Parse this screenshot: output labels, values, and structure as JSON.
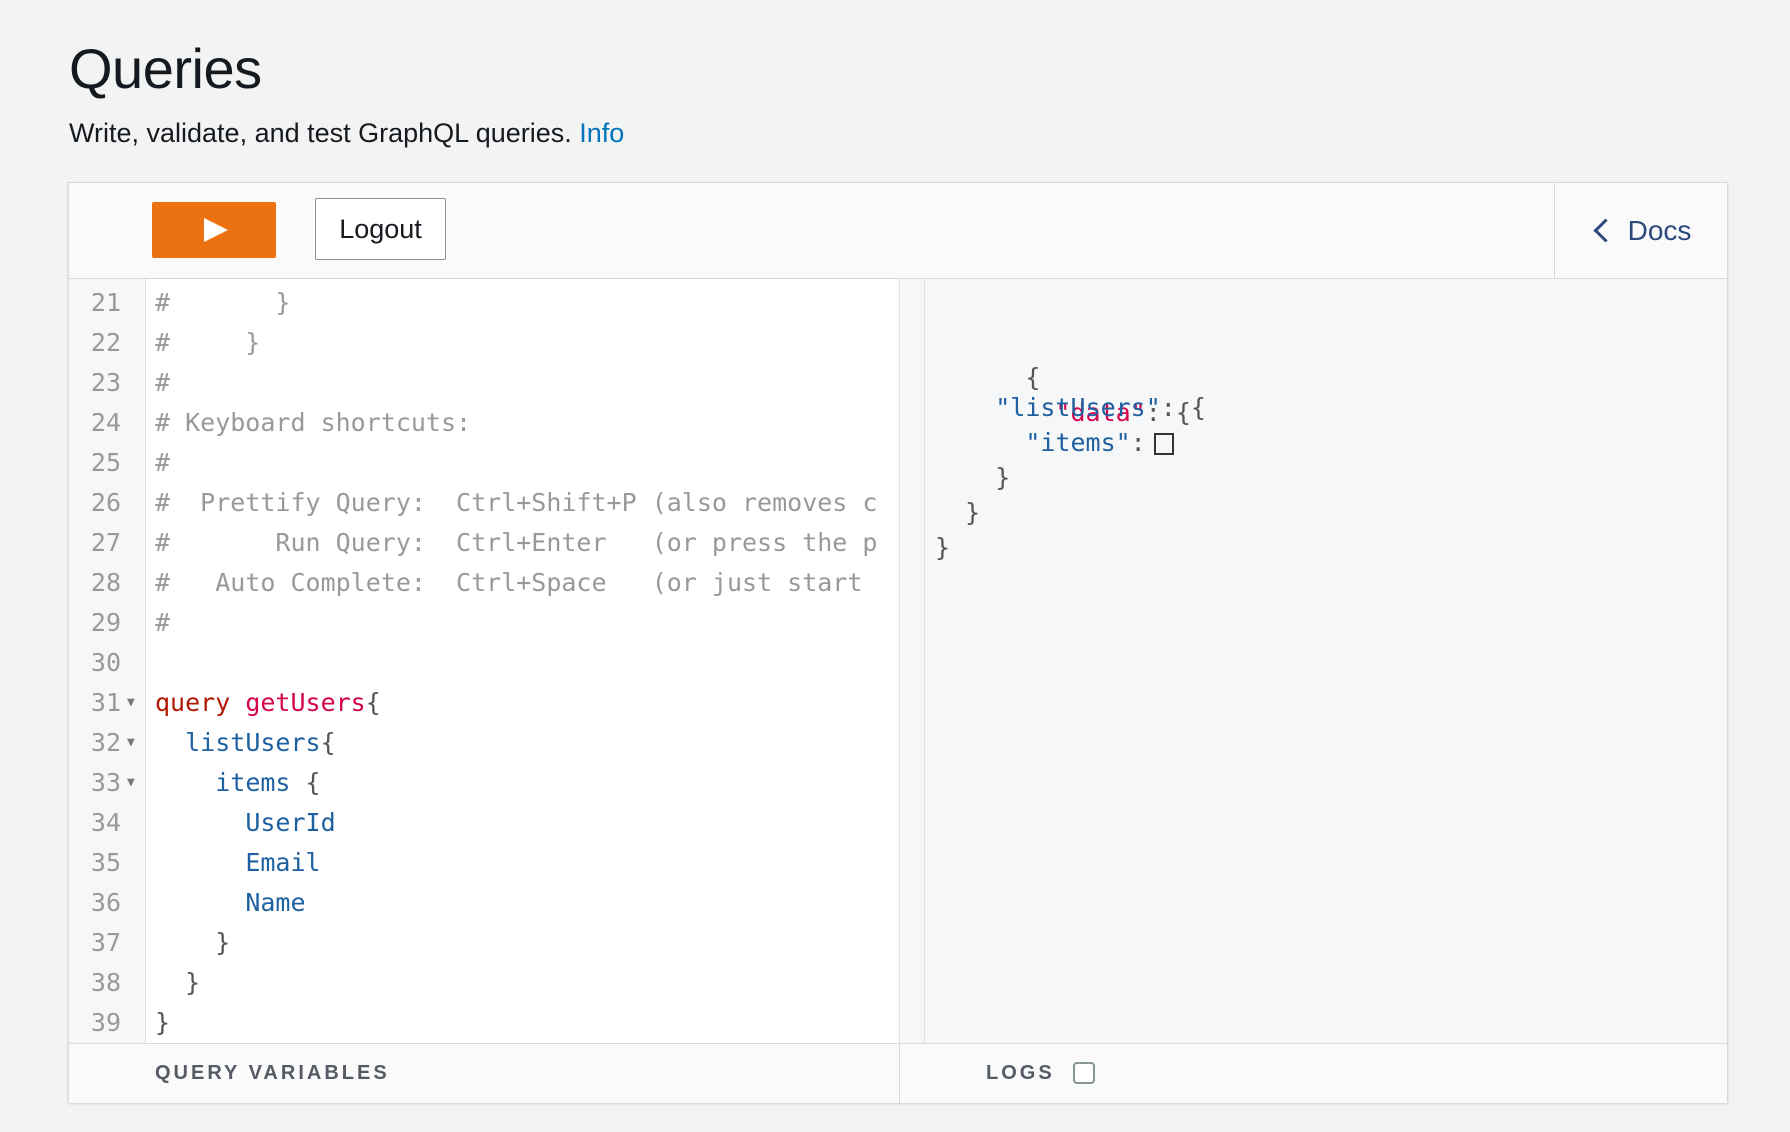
{
  "page": {
    "title": "Queries",
    "description": "Write, validate, and test GraphQL queries.",
    "info_link": "Info"
  },
  "toolbar": {
    "run_icon": "play-icon",
    "logout_label": "Logout",
    "docs_label": "Docs"
  },
  "editor": {
    "lines": [
      {
        "n": "21",
        "t": "#       }"
      },
      {
        "n": "22",
        "t": "#     }"
      },
      {
        "n": "23",
        "t": "#"
      },
      {
        "n": "24",
        "t": "# Keyboard shortcuts:"
      },
      {
        "n": "25",
        "t": "#"
      },
      {
        "n": "26",
        "t": "#  Prettify Query:  Ctrl+Shift+P (also removes c"
      },
      {
        "n": "27",
        "t": "#       Run Query:  Ctrl+Enter   (or press the p"
      },
      {
        "n": "28",
        "t": "#   Auto Complete:  Ctrl+Space   (or just start"
      },
      {
        "n": "29",
        "t": "#"
      },
      {
        "n": "30",
        "t": ""
      },
      {
        "n": "31",
        "kw": "query",
        "def": "getUsers",
        "p": "{"
      },
      {
        "n": "32",
        "indent": "  ",
        "field": "listUsers",
        "p": "{"
      },
      {
        "n": "33",
        "indent": "    ",
        "field": "items",
        "p": " {"
      },
      {
        "n": "34",
        "indent": "      ",
        "field": "UserId"
      },
      {
        "n": "35",
        "indent": "      ",
        "field": "Email"
      },
      {
        "n": "36",
        "indent": "      ",
        "field": "Name"
      },
      {
        "n": "37",
        "indent": "    ",
        "p": "}"
      },
      {
        "n": "38",
        "indent": "  ",
        "p": "}"
      },
      {
        "n": "39",
        "p": "}"
      }
    ]
  },
  "result": {
    "open_brace": "{",
    "data_key": "\"data\"",
    "list_key": "\"listUsers\"",
    "items_key": "\"items\"",
    "colon_brace": ": {",
    "colon": ":",
    "close_brace": "}"
  },
  "footer": {
    "query_variables_label": "QUERY VARIABLES",
    "logs_label": "LOGS"
  }
}
